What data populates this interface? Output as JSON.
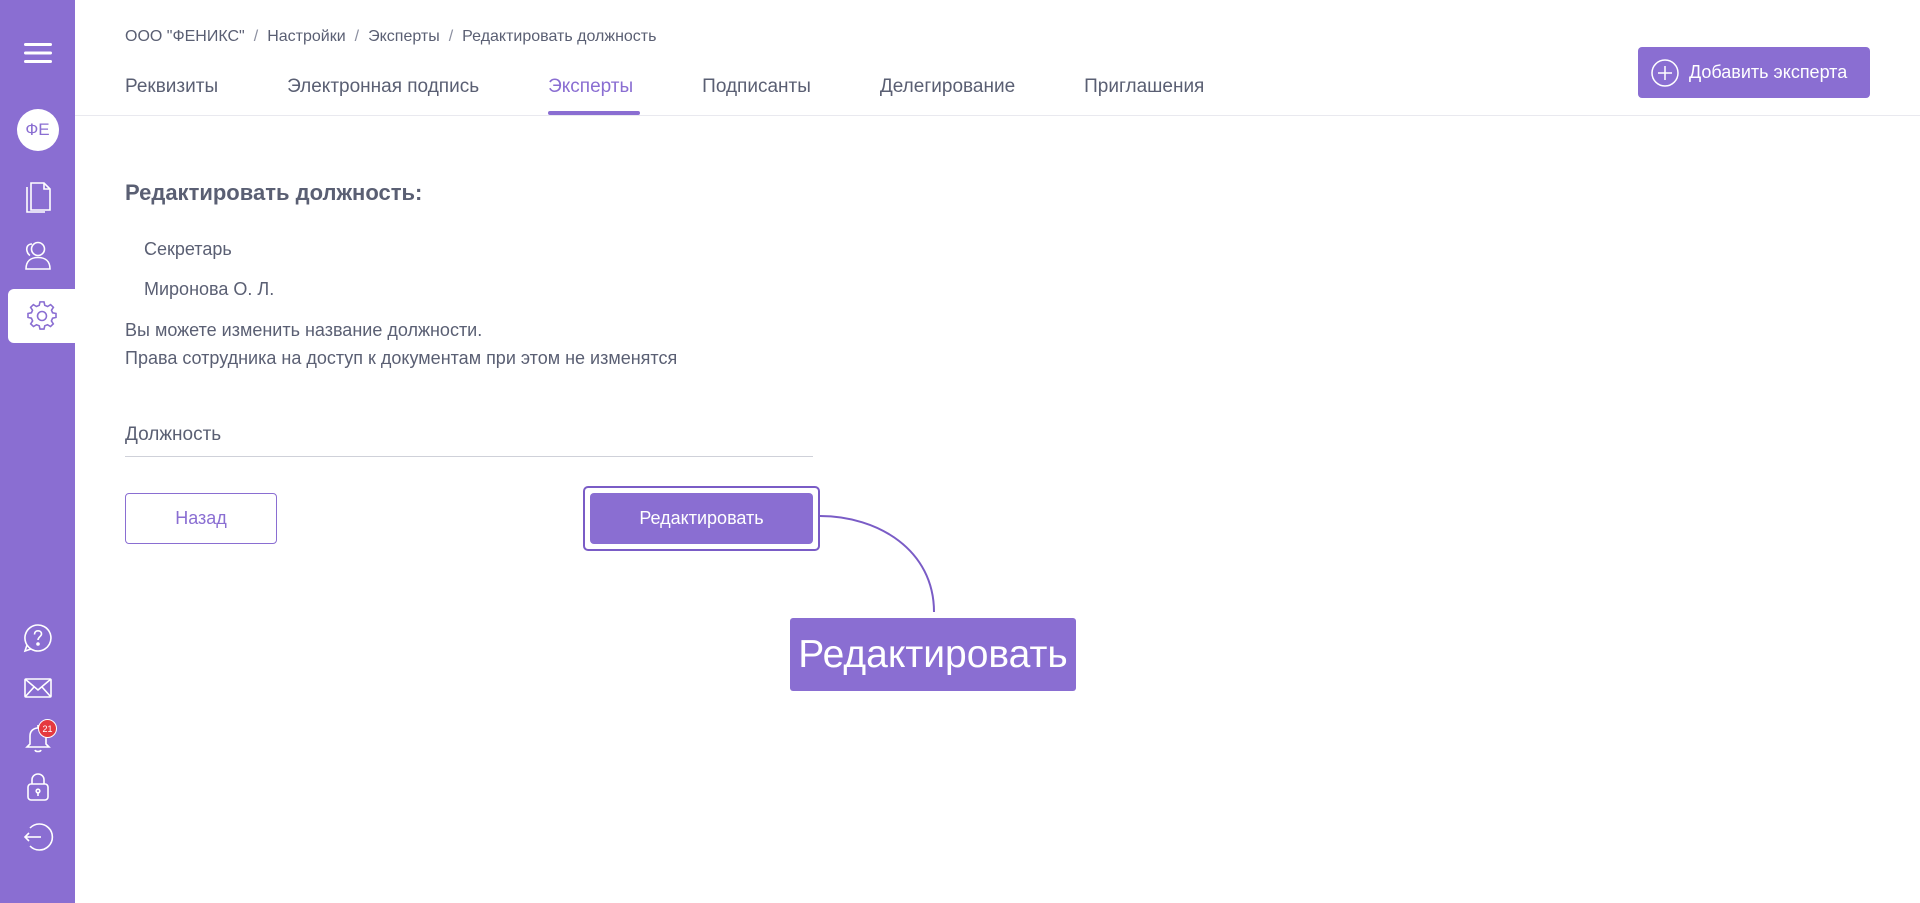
{
  "sidebar": {
    "avatar_initials": "ФЕ",
    "notifications_count": "21",
    "accent_color": "#8a6ed2",
    "icons": [
      "menu-icon",
      "document-icon",
      "users-icon",
      "gear-icon",
      "help-icon",
      "mail-icon",
      "bell-icon",
      "lock-icon",
      "logout-icon"
    ]
  },
  "breadcrumb": {
    "items": [
      "ООО \"ФЕНИКС\"",
      "Настройки",
      "Эксперты",
      "Редактировать должность"
    ],
    "separator": "/"
  },
  "tabs": [
    {
      "label": "Реквизиты",
      "active": false
    },
    {
      "label": "Электронная подпись",
      "active": false
    },
    {
      "label": "Эксперты",
      "active": true
    },
    {
      "label": "Подписанты",
      "active": false
    },
    {
      "label": "Делегирование",
      "active": false
    },
    {
      "label": "Приглашения",
      "active": false
    }
  ],
  "header": {
    "add_button_label": "Добавить эксперта"
  },
  "form": {
    "title": "Редактировать должность:",
    "position": "Секретарь",
    "person": "Миронова О. Л.",
    "note_line1": "Вы можете изменить название должности.",
    "note_line2": "Права сотрудника на доступ к документам при этом не изменятся",
    "field_placeholder": "Должность",
    "field_value": "",
    "back_label": "Назад",
    "edit_label": "Редактировать"
  },
  "callout": {
    "text": "Редактировать"
  }
}
